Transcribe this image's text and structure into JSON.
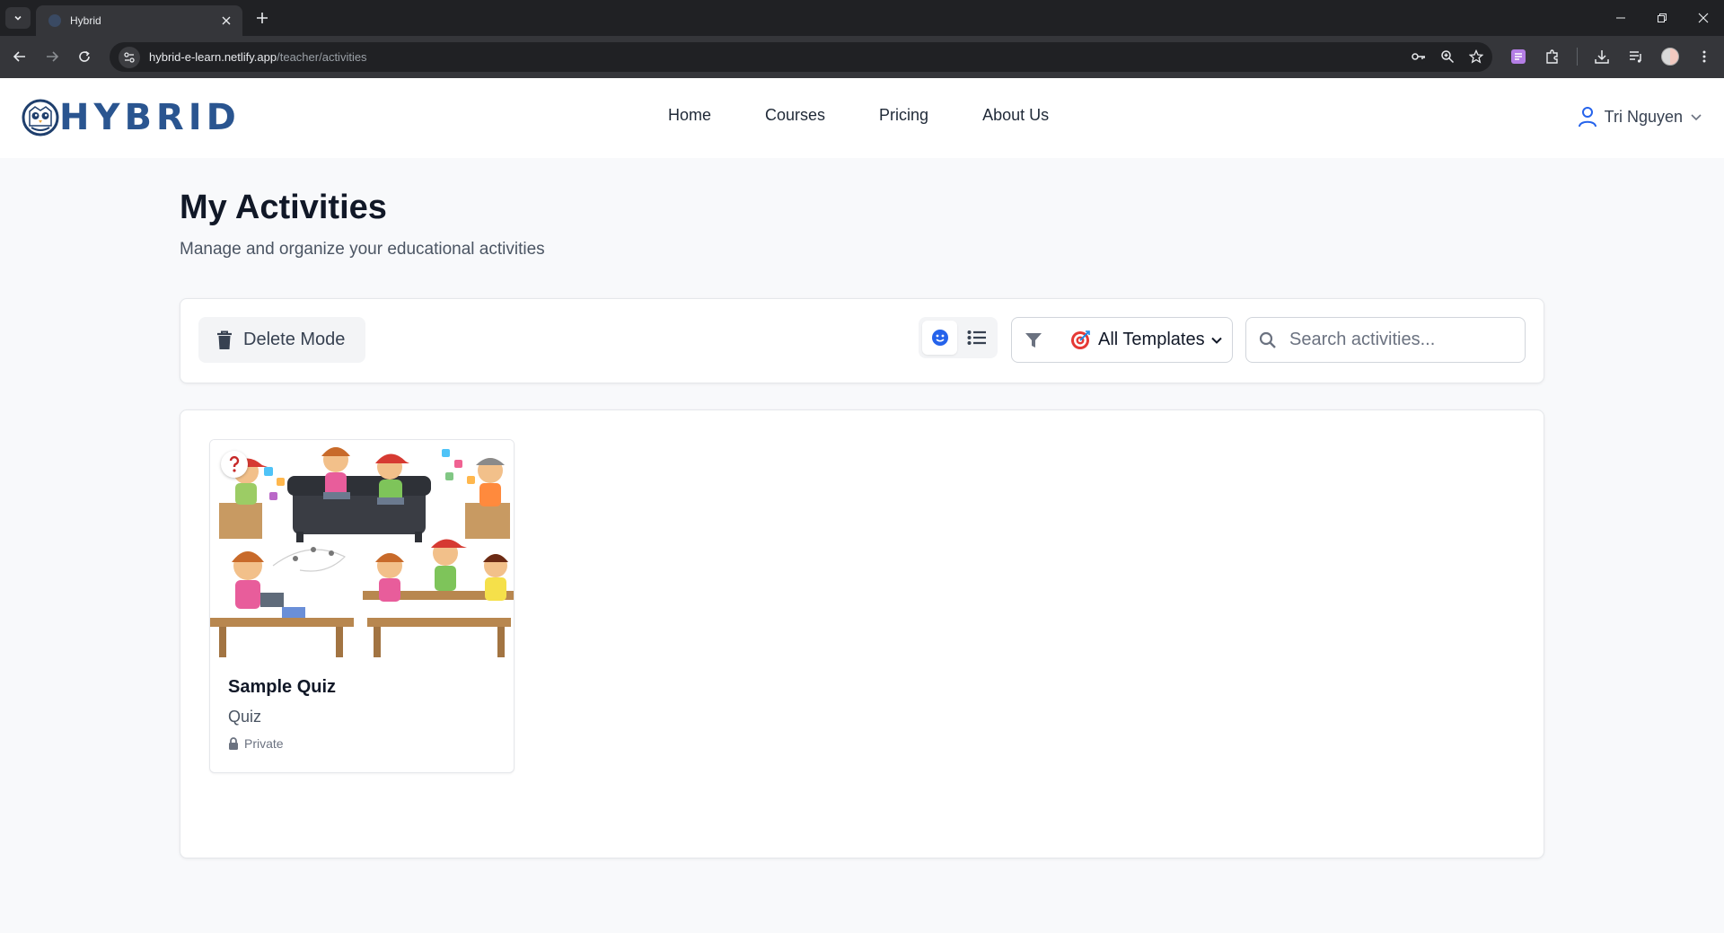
{
  "browser": {
    "tab_title": "Hybrid",
    "url_host": "hybrid-e-learn.netlify.app",
    "url_path": "/teacher/activities"
  },
  "site": {
    "logo_text": "HYBRID",
    "nav": [
      "Home",
      "Courses",
      "Pricing",
      "About Us"
    ],
    "user_name": "Tri Nguyen"
  },
  "page": {
    "title": "My Activities",
    "subtitle": "Manage and organize your educational activities"
  },
  "toolbar": {
    "delete_mode_label": "Delete Mode",
    "view_mode": "grid",
    "template_filter": "All Templates",
    "search_placeholder": "Search activities..."
  },
  "activities": [
    {
      "title": "Sample Quiz",
      "type": "Quiz",
      "visibility": "Private",
      "badge_icon": "question-mark-icon"
    }
  ],
  "colors": {
    "brand": "#2a5590",
    "accent_blue": "#2563eb",
    "chrome_dark": "#202124",
    "chrome_toolbar": "#35363a"
  }
}
